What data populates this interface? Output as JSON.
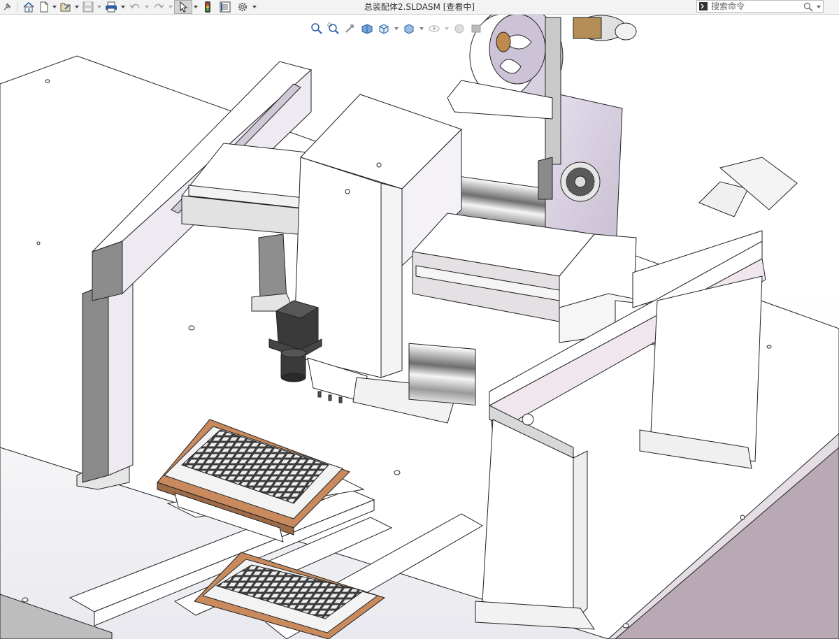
{
  "toolbar": {
    "pin": "pin-icon",
    "home": "home-icon",
    "new": "new-document-icon",
    "open": "open-file-icon",
    "save": "save-icon",
    "print": "print-icon",
    "undo": "undo-icon",
    "redo": "redo-icon",
    "select": "select-pointer-icon",
    "rebuild": "traffic-light-icon",
    "file_properties": "file-properties-icon",
    "options": "gear-icon"
  },
  "document_title": "总装配体2.SLDASM [查看中]",
  "search": {
    "placeholder": "搜索命令",
    "prompt_icon": "command-prompt-icon",
    "icon": "search-icon"
  },
  "view_toolbar": {
    "items": [
      "zoom-to-fit-icon",
      "zoom-to-area-icon",
      "previous-view-icon",
      "section-view-icon",
      "view-orientation-icon",
      "display-style-icon",
      "hide-show-items-icon",
      "edit-appearance-icon",
      "apply-scene-icon"
    ]
  },
  "colors": {
    "toolbar_bg": "#f3f3f3",
    "copper_tray": "#c98a5e",
    "machine_gray": "#9a9a9a",
    "lavender_part": "#d8cfe0",
    "camera_dark": "#333333"
  }
}
